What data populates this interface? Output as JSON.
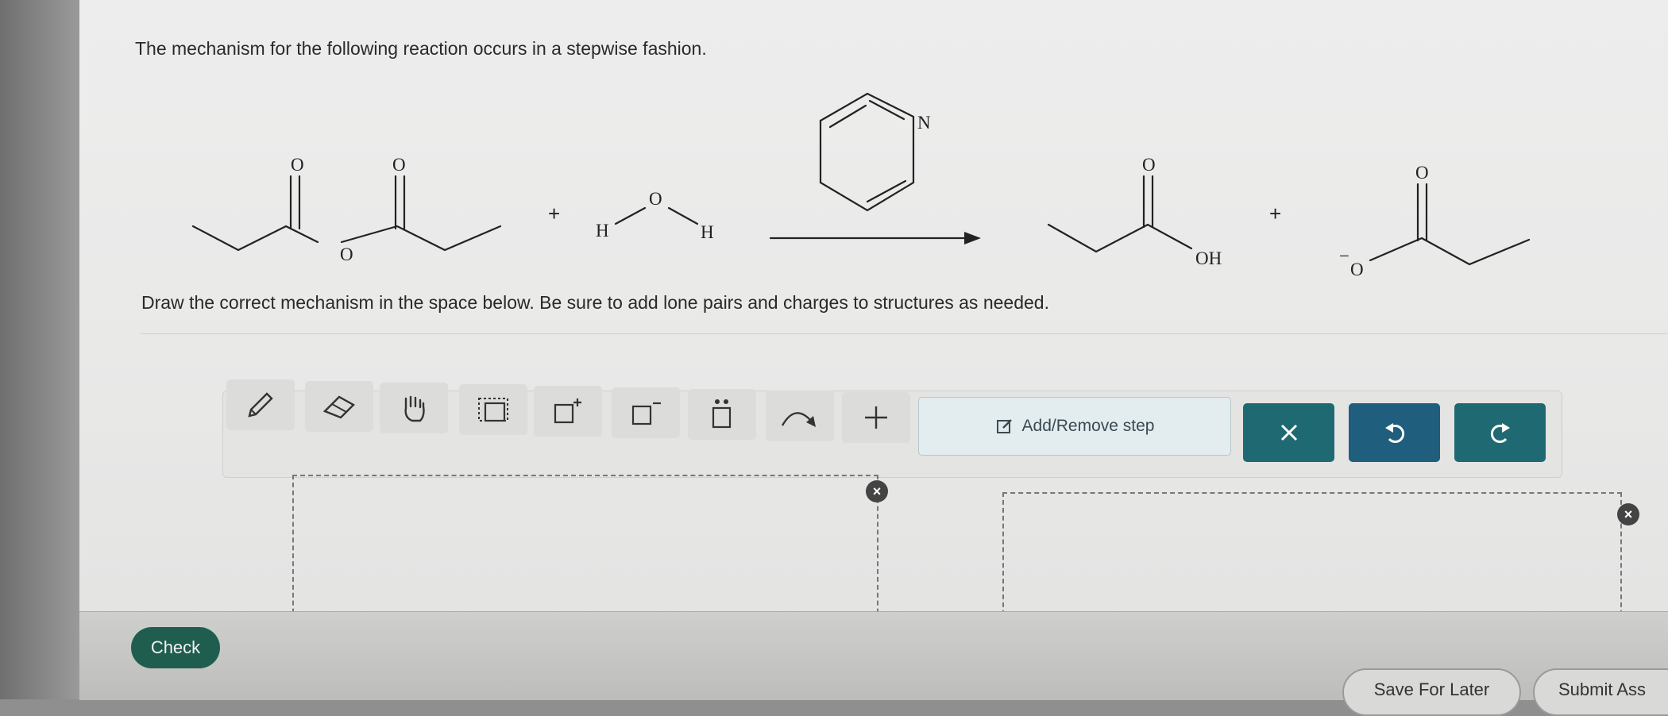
{
  "question": {
    "text": "The mechanism for the following reaction occurs in a stepwise fashion.",
    "instructions": "Draw the correct mechanism in the space below. Be sure to add lone pairs and charges to structures as needed."
  },
  "reaction": {
    "reactant1": {
      "atoms": [
        "O",
        "O",
        "O"
      ]
    },
    "plus1": "+",
    "reactant2": {
      "atoms": [
        "H",
        "O",
        "H"
      ]
    },
    "reagent": {
      "atom": "N"
    },
    "product1": {
      "atoms": [
        "O",
        "OH"
      ]
    },
    "plus2": "+",
    "product2": {
      "atoms": [
        "O",
        "O"
      ],
      "charge": "−"
    }
  },
  "toolbar": {
    "tools": [
      {
        "name": "pencil-tool",
        "icon": "pencil-icon"
      },
      {
        "name": "eraser-tool",
        "icon": "eraser-icon"
      },
      {
        "name": "hand-tool",
        "icon": "hand-icon"
      },
      {
        "name": "select-tool",
        "icon": "select-box-icon"
      },
      {
        "name": "positive-charge-tool",
        "icon": "positive-charge-icon"
      },
      {
        "name": "negative-charge-tool",
        "icon": "negative-charge-icon"
      },
      {
        "name": "lone-pair-tool",
        "icon": "lone-pair-icon"
      },
      {
        "name": "curved-arrow-tool",
        "icon": "curved-arrow-icon"
      },
      {
        "name": "add-plus-tool",
        "icon": "plus-icon"
      }
    ],
    "add_remove_step_label": "Add/Remove step",
    "clear_icon": "close-icon",
    "undo_icon": "undo-icon",
    "redo_icon": "redo-icon"
  },
  "steps": {
    "close_glyph": "×"
  },
  "footer": {
    "check_label": "Check",
    "save_label": "Save For Later",
    "submit_label": "Submit Ass"
  },
  "colors": {
    "teal": "#1f6a72",
    "check_green": "#1f5e4f"
  }
}
